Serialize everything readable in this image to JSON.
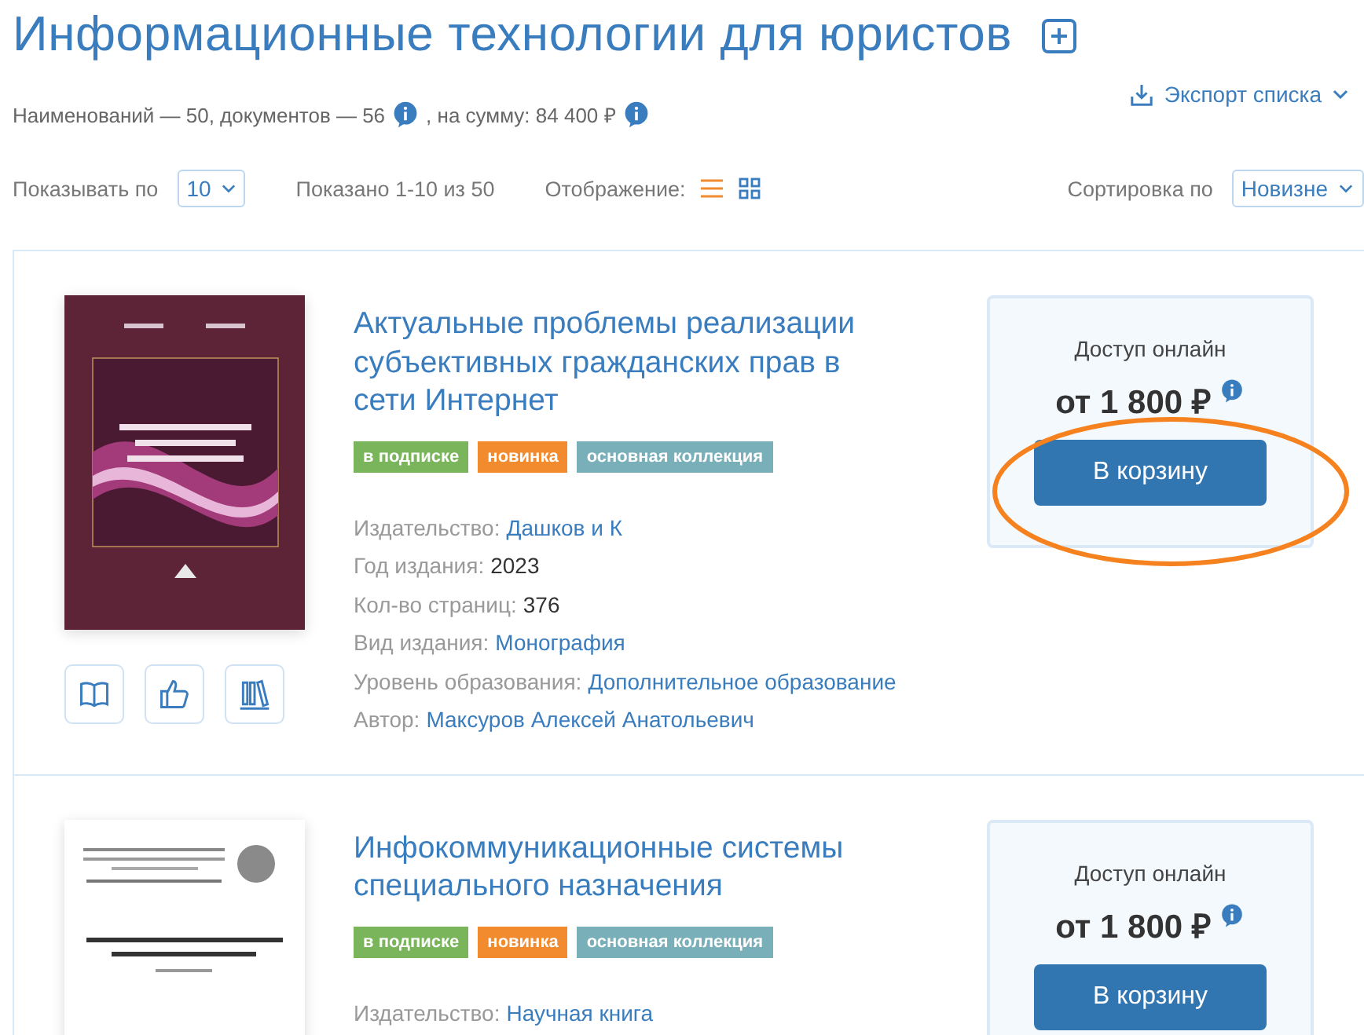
{
  "header": {
    "title": "Информационные технологии для юристов",
    "summary_items": "Наименований — 50, документов — 56",
    "summary_sum": ", на сумму: 84 400 ₽",
    "export": "Экспорт списка"
  },
  "toolbar": {
    "per_page_label": "Показывать по",
    "per_page_value": "10",
    "shown": "Показано 1-10 из 50",
    "view_label": "Отображение:",
    "view_options": [
      {
        "kind": "list",
        "selected": true
      },
      {
        "kind": "grid",
        "selected": false
      }
    ],
    "sort_label": "Сортировка по",
    "sort_value": "Новизне"
  },
  "books": [
    {
      "title": "Актуальные проблемы реализации субъективных гражданских прав в сети Интернет",
      "tags": [
        {
          "label": "в подписке",
          "color": "#7ab55c"
        },
        {
          "label": "новинка",
          "color": "#f28a2e"
        },
        {
          "label": "основная коллекция",
          "color": "#79afb8"
        }
      ],
      "details": [
        {
          "label": "Издательство:",
          "value": "Дашков и К",
          "kind": "link"
        },
        {
          "label": "Год издания:",
          "value": "2023",
          "kind": "text"
        },
        {
          "label": "Кол-во страниц:",
          "value": "376",
          "kind": "text"
        },
        {
          "label": "Вид издания:",
          "value": "Монография",
          "kind": "link"
        },
        {
          "label": "Уровень образования:",
          "value": "Дополнительное образование",
          "kind": "link"
        },
        {
          "label": "Автор:",
          "value": "Максуров Алексей Анатольевич",
          "kind": "link"
        }
      ],
      "actions": true,
      "offer": {
        "access": "Доступ онлайн",
        "price": "от 1 800 ₽",
        "button": "В корзину",
        "circled": true
      }
    },
    {
      "title": "Инфокоммуникационные системы специального назначения",
      "tags": [
        {
          "label": "в подписке",
          "color": "#7ab55c"
        },
        {
          "label": "новинка",
          "color": "#f28a2e"
        },
        {
          "label": "основная коллекция",
          "color": "#79afb8"
        }
      ],
      "details": [
        {
          "label": "Издательство:",
          "value": "Научная книга",
          "kind": "link"
        }
      ],
      "actions": false,
      "offer": {
        "access": "Доступ онлайн",
        "price": "от 1 800 ₽",
        "button": "В корзину",
        "circled": false
      }
    }
  ]
}
